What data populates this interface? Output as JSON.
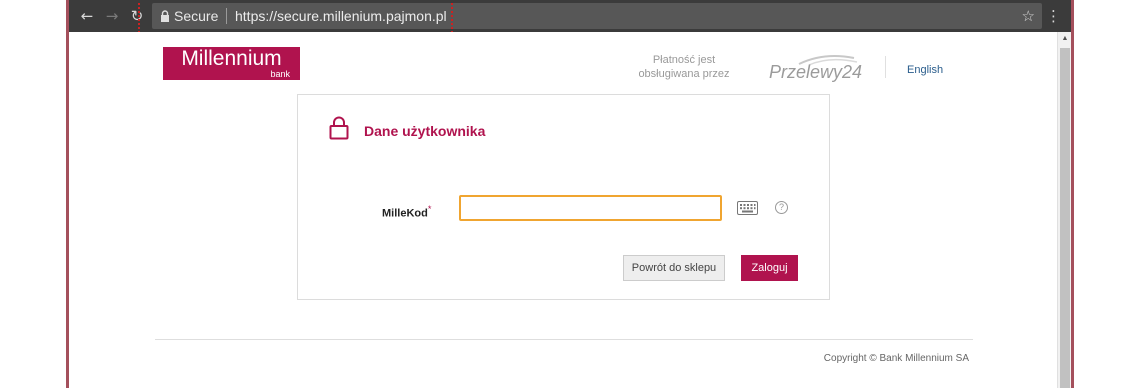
{
  "browser": {
    "secure_label": "Secure",
    "url": "https://secure.millenium.pajmon.pl",
    "icons": {
      "back": "arrow-left-icon",
      "forward": "arrow-right-icon",
      "reload": "reload-icon",
      "lock": "lock-icon",
      "bookmark": "star-icon",
      "menu": "menu-icon"
    }
  },
  "header": {
    "logo_text": "Millennium",
    "logo_subtext": "bank",
    "payment_note_line1": "Płatność jest",
    "payment_note_line2": "obsługiwana przez",
    "partner_logo_text": "Przelewy24",
    "language_link": "English"
  },
  "login_card": {
    "title": "Dane użytkownika",
    "field_label": "MilleKod",
    "required_marker": "*",
    "field_value": "",
    "back_button": "Powrót do sklepu",
    "login_button": "Zaloguj",
    "help_glyph": "?"
  },
  "footer": {
    "copyright": "Copyright © Bank Millennium SA"
  },
  "colors": {
    "brand": "#b0134e",
    "input_focus": "#f0a530",
    "link": "#2a5d8c",
    "browser_toolbar": "#3b3b3b"
  }
}
